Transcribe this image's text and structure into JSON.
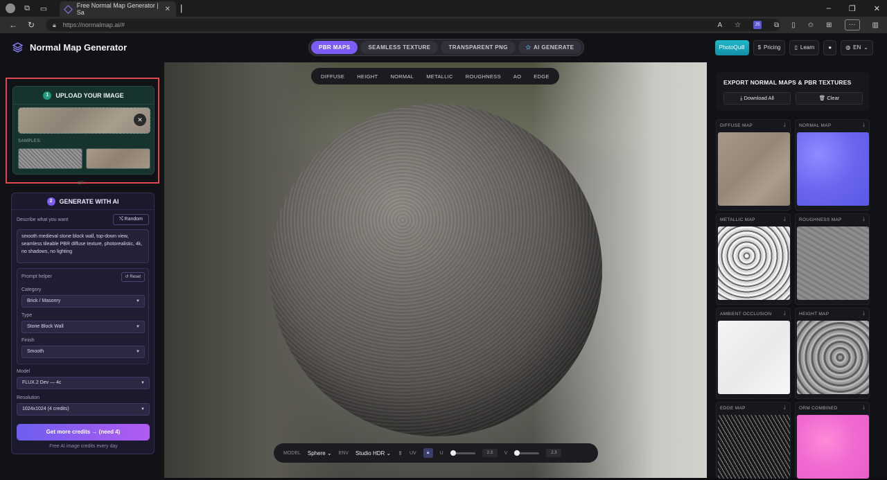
{
  "browser": {
    "tab_title": "Free Normal Map Generator | Sa",
    "url": "https://normalmap.ai/#",
    "ext_badge": "JS"
  },
  "app": {
    "title": "Normal Map Generator",
    "modes": [
      "PBR MAPS",
      "SEAMLESS TEXTURE",
      "TRANSPARENT PNG",
      "AI GENERATE"
    ],
    "active_mode": "PBR MAPS",
    "photoquill": "PhotoQuill",
    "pricing": "Pricing",
    "learn": "Learn",
    "language": "EN"
  },
  "upload": {
    "step": "1",
    "title": "UPLOAD YOUR IMAGE",
    "samples_label": "SAMPLES:",
    "or_label": "OR"
  },
  "generate": {
    "step": "2",
    "title": "GENERATE WITH AI",
    "describe_label": "Describe what you want",
    "random_label": "Random",
    "prompt": "smooth medieval stone block wall, top-down view, seamless tileable PBR diffuse texture, photorealistic, 4k, no shadows, no lighting",
    "helper_label": "Prompt helper",
    "reset_label": "Reset",
    "category_label": "Category",
    "category_value": "Brick / Masonry",
    "type_label": "Type",
    "type_value": "Stone Block Wall",
    "finish_label": "Finish",
    "finish_value": "Smooth",
    "model_label": "Model",
    "model_value": "FLUX.2 Dev — 4c",
    "resolution_label": "Resolution",
    "resolution_value": "1024x1024 (4 credits)",
    "credits_button": "Get more credits → (need 4)",
    "free_note": "Free AI image credits every day"
  },
  "viewport": {
    "map_tabs": [
      "DIFFUSE",
      "HEIGHT",
      "NORMAL",
      "METALLIC",
      "ROUGHNESS",
      "AO",
      "EDGE"
    ],
    "model_label": "MODEL",
    "model_value": "Sphere",
    "env_label": "ENV",
    "env_value": "Studio HDR",
    "uv_label": "UV",
    "u_label": "U",
    "u_value": "2.3",
    "v_label": "V",
    "v_value": "2.3"
  },
  "export": {
    "title": "EXPORT NORMAL MAPS & PBR TEXTURES",
    "download_all": "Download All",
    "clear": "Clear",
    "maps": [
      "DIFFUSE MAP",
      "NORMAL MAP",
      "METALLIC MAP",
      "ROUGHNESS MAP",
      "AMBIENT OCCLUSION",
      "HEIGHT MAP",
      "EDGE MAP",
      "ORM COMBINED"
    ]
  },
  "colors": {
    "accent": "#7b5cf6",
    "upload_highlight": "#e0474f",
    "teal": "#1f9c7e"
  }
}
